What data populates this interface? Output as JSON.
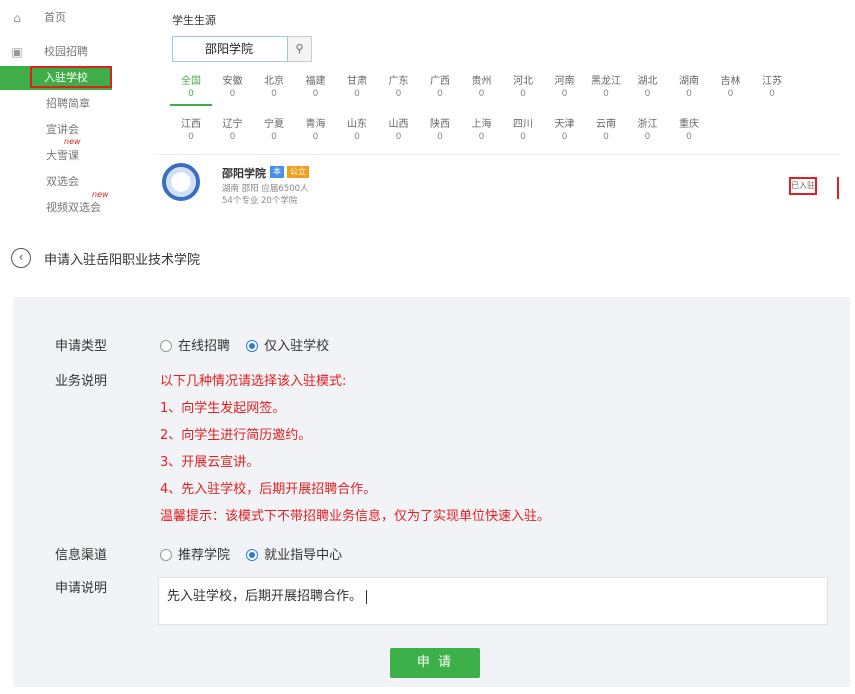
{
  "sidebar": {
    "items": [
      {
        "icon": "home-icon",
        "label": "首页"
      },
      {
        "icon": "campus-icon",
        "label": "校园招聘"
      },
      {
        "label": "入驻学校"
      },
      {
        "label": "招聘简章"
      },
      {
        "label": "宣讲会"
      },
      {
        "label": "大雪课"
      },
      {
        "label": "双选会"
      },
      {
        "label": "视频双选会"
      }
    ],
    "new_badge": "new"
  },
  "main": {
    "title": "学生生源",
    "search_value": "邵阳学院",
    "search_icon": "search-icon"
  },
  "provinces_row1": [
    {
      "name": "全国",
      "count": "0"
    },
    {
      "name": "安徽",
      "count": "0"
    },
    {
      "name": "北京",
      "count": "0"
    },
    {
      "name": "福建",
      "count": "0"
    },
    {
      "name": "甘肃",
      "count": "0"
    },
    {
      "name": "广东",
      "count": "0"
    },
    {
      "name": "广西",
      "count": "0"
    },
    {
      "name": "贵州",
      "count": "0"
    },
    {
      "name": "河北",
      "count": "0"
    },
    {
      "name": "河南",
      "count": "0"
    },
    {
      "name": "黑龙江",
      "count": "0"
    },
    {
      "name": "湖北",
      "count": "0"
    },
    {
      "name": "湖南",
      "count": "0"
    },
    {
      "name": "吉林",
      "count": "0"
    },
    {
      "name": "江苏",
      "count": "0"
    }
  ],
  "provinces_row2": [
    {
      "name": "江西",
      "count": "0"
    },
    {
      "name": "辽宁",
      "count": "0"
    },
    {
      "name": "宁夏",
      "count": "0"
    },
    {
      "name": "青海",
      "count": "0"
    },
    {
      "name": "山东",
      "count": "0"
    },
    {
      "name": "山西",
      "count": "0"
    },
    {
      "name": "陕西",
      "count": "0"
    },
    {
      "name": "上海",
      "count": "0"
    },
    {
      "name": "四川",
      "count": "0"
    },
    {
      "name": "天津",
      "count": "0"
    },
    {
      "name": "云南",
      "count": "0"
    },
    {
      "name": "浙江",
      "count": "0"
    },
    {
      "name": "重庆",
      "count": "0"
    }
  ],
  "school": {
    "name": "邵阳学院",
    "tag1": "本",
    "tag2": "公立",
    "meta1": "湖南 邵阳 应届6500人",
    "meta2": "54个专业 20个学院",
    "status": "已入驻"
  },
  "form": {
    "back_icon": "chevron-left-icon",
    "title": "申请入驻岳阳职业技术学院",
    "type_label": "申请类型",
    "type_options": [
      "在线招聘",
      "仅入驻学校"
    ],
    "type_selected": 1,
    "desc_label": "业务说明",
    "desc_lines": [
      "以下几种情况请选择该入驻模式:",
      "1、向学生发起网签。",
      "2、向学生进行简历邀约。",
      "3、开展云宣讲。",
      "4、先入驻学校，后期开展招聘合作。",
      "温馨提示：该模式下不带招聘业务信息，仅为了实现单位快速入驻。"
    ],
    "channel_label": "信息渠道",
    "channel_options": [
      "推荐学院",
      "就业指导中心"
    ],
    "channel_selected": 1,
    "note_label": "申请说明",
    "note_value": "先入驻学校，后期开展招聘合作。",
    "submit_label": "申 请",
    "accent_color": "#3db04a",
    "warning_color": "#e02020"
  }
}
